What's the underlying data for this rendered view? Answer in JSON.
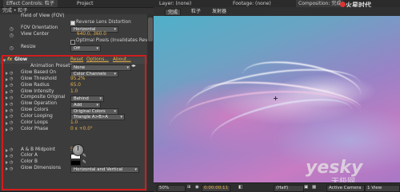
{
  "left_panel": {
    "tabs": [
      "Effect Controls: 粒子",
      "Project"
    ],
    "breadcrumb": "完成 • 粒子",
    "top_rows": [
      {
        "label": "Field of View (FOV)",
        "value": ""
      },
      {
        "label": "FOV Orientation",
        "value": "Horizontal",
        "kind": "dropdown"
      },
      {
        "label": "View Center",
        "value": "640.0, 360.0",
        "kind": "number"
      },
      {
        "label": "Resize",
        "value": "Off",
        "kind": "dropdown"
      }
    ],
    "checkbox_rows": {
      "reverse": "Reverse Lens Distortion",
      "optimal": "Optimal Pixels (Invalidates Rev"
    },
    "effect": {
      "fx_label": "fx",
      "name": "Glow",
      "reset": "Reset",
      "options": "Options...",
      "about": "About...",
      "presets_label": "Animation Presets:",
      "presets_value": "None"
    },
    "glow_rows": [
      {
        "label": "Glow Based On",
        "value": "Color Channels",
        "kind": "dropdown"
      },
      {
        "label": "Glow Threshold",
        "value": "95.2%",
        "kind": "number"
      },
      {
        "label": "Glow Radius",
        "value": "65.0",
        "kind": "number"
      },
      {
        "label": "Glow Intensity",
        "value": "1.0",
        "kind": "number"
      },
      {
        "label": "Composite Original",
        "value": "Behind",
        "kind": "dropdown"
      },
      {
        "label": "Glow Operation",
        "value": "Add",
        "kind": "dropdown"
      },
      {
        "label": "Glow Colors",
        "value": "Original Colors",
        "kind": "dropdown"
      },
      {
        "label": "Color Looping",
        "value": "Triangle A>B>A",
        "kind": "dropdown"
      },
      {
        "label": "Color Loops",
        "value": "1.0",
        "kind": "number"
      },
      {
        "label": "Color Phase",
        "value": "0 x +0.0°",
        "kind": "number"
      },
      {
        "label": "A & B Midpoint",
        "value": "50%",
        "kind": "number"
      },
      {
        "label": "Color A",
        "value": "#ffffff",
        "kind": "swatch"
      },
      {
        "label": "Color B",
        "value": "#000000",
        "kind": "swatch"
      },
      {
        "label": "Glow Dimensions",
        "value": "Horizontal and Vertical",
        "kind": "dropdown"
      }
    ]
  },
  "right_panel": {
    "tabs": [
      "Layer: (none)",
      "Footage: (none)",
      "Composition: 完成"
    ],
    "sub_tabs": [
      "完成",
      "粒子",
      "发射器"
    ],
    "logo": "火星时代",
    "bottom": {
      "zoom": "50%",
      "timecode": "0:00:00:11",
      "resolution": "(Half)",
      "camera": "Active Camera",
      "view": "1 View"
    },
    "watermark": "yesky",
    "watermark_sub": "天极网"
  },
  "colors": {
    "accent_orange": "#e8b04a",
    "highlight_box": "#d21d1d",
    "panel_bg": "#3c3c3c"
  }
}
